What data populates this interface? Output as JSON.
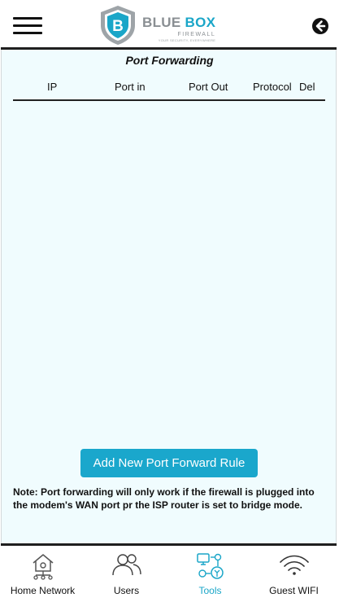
{
  "header": {
    "menu_icon": "hamburger-menu-icon",
    "logo": {
      "word1": "BLUE",
      "word2": "BOX",
      "sub": "FIREWALL",
      "tagline": "YOUR SECURITY, EVERYWHERE",
      "shield_letter": "B"
    },
    "back_icon": "back-arrow-circle-icon"
  },
  "page": {
    "title": "Port Forwarding",
    "columns": [
      "IP",
      "Port in",
      "Port Out",
      "Protocol",
      "Del"
    ],
    "rows": []
  },
  "actions": {
    "add_button": "Add New Port Forward Rule"
  },
  "note": "Note: Port forwarding will only work if the firewall is plugged into the modem's WAN port pr the ISP router is set to bridge mode.",
  "bottom_nav": {
    "items": [
      {
        "label": "Home Network",
        "icon": "home-network-icon",
        "active": false
      },
      {
        "label": "Users",
        "icon": "users-icon",
        "active": false
      },
      {
        "label": "Tools",
        "icon": "tools-icon",
        "active": true
      },
      {
        "label": "Guest WIFI",
        "icon": "wifi-icon",
        "active": false
      }
    ]
  },
  "colors": {
    "accent": "#1aa6c8",
    "background": "#f0fcfe",
    "text": "#111111",
    "logo_gray": "#8a8f93"
  }
}
